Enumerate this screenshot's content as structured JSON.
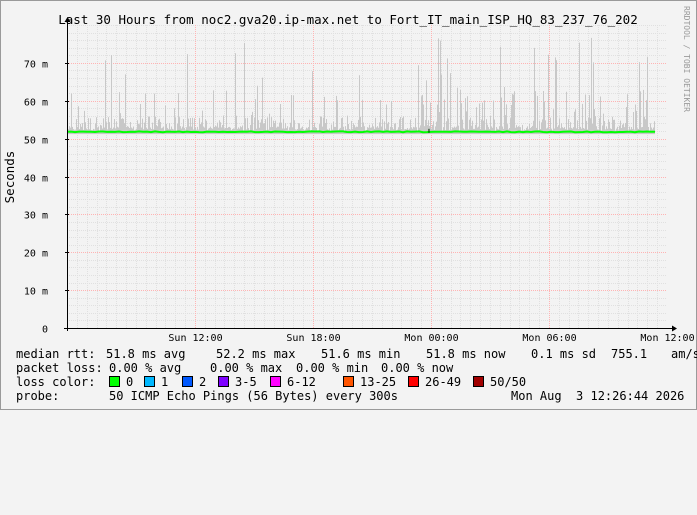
{
  "chart_data": {
    "type": "line",
    "title": "Last 30 Hours from noc2.gva20.ip-max.net to Fort_IT_main_ISP_HQ_83_237_76_202",
    "ylabel": "Seconds",
    "xlabel": "",
    "ylim": [
      0,
      80
    ],
    "y_ticks": [
      {
        "value": 0,
        "label": "0"
      },
      {
        "value": 10,
        "label": "10 m"
      },
      {
        "value": 20,
        "label": "20 m"
      },
      {
        "value": 30,
        "label": "30 m"
      },
      {
        "value": 40,
        "label": "40 m"
      },
      {
        "value": 50,
        "label": "50 m"
      },
      {
        "value": 60,
        "label": "60 m"
      },
      {
        "value": 70,
        "label": "70 m"
      }
    ],
    "x_ticks": [
      {
        "hours": 6.5,
        "label": "Sun 12:00"
      },
      {
        "hours": 12.5,
        "label": "Sun 18:00"
      },
      {
        "hours": 18.5,
        "label": "Mon 00:00"
      },
      {
        "hours": 24.5,
        "label": "Mon 06:00"
      },
      {
        "hours": 30.5,
        "label": "Mon 12:00"
      }
    ],
    "x_range_hours": [
      0,
      30.5
    ],
    "grid": true,
    "median_line_value": 51.8,
    "colors": {
      "median": "#00ff00",
      "smoke": "#c8c8c8",
      "grid_major": "#ffb3b3",
      "grid_minor": "#e0e0e0"
    },
    "watermark": "RRDTOOL / TOBI OETIKER"
  },
  "stats": {
    "median": {
      "label": "median rtt:",
      "avg": "51.8 ms avg",
      "max": "52.2 ms max",
      "min": "51.6 ms min",
      "now": "51.8 ms now",
      "sd": "0.1 ms sd",
      "am": "755.1",
      "unit": "am/s"
    },
    "loss": {
      "label": "packet loss:",
      "avg": "0.00 % avg",
      "max": "0.00 % max",
      "min": "0.00 % min",
      "now": "0.00 % now"
    },
    "loss_color": {
      "label": "loss color:",
      "items": [
        {
          "label": "0",
          "color": "#00ff00"
        },
        {
          "label": "1",
          "color": "#00b8ff"
        },
        {
          "label": "2",
          "color": "#0059ff"
        },
        {
          "label": "3-5",
          "color": "#7e00ff"
        },
        {
          "label": "6-12",
          "color": "#ff00ff"
        },
        {
          "label": "13-25",
          "color": "#ff5500"
        },
        {
          "label": "26-49",
          "color": "#ff0000"
        },
        {
          "label": "50/50",
          "color": "#a10000"
        }
      ]
    },
    "probe": {
      "label": "probe:",
      "text": "50 ICMP Echo Pings (56 Bytes) every 300s",
      "date": "Mon Aug  3 12:26:44 2026"
    }
  }
}
